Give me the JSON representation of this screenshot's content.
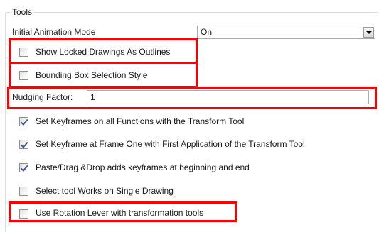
{
  "group": {
    "title": "Tools"
  },
  "animation_mode": {
    "label": "Initial Animation Mode",
    "value": "On"
  },
  "options": [
    {
      "label": "Show Locked Drawings As Outlines",
      "checked": false
    },
    {
      "label": "Bounding Box Selection Style",
      "checked": false
    }
  ],
  "nudging": {
    "label": "Nudging Factor:",
    "value": "1"
  },
  "options2": [
    {
      "label": "Set Keyframes on all Functions with the Transform Tool",
      "checked": true
    },
    {
      "label": "Set Keyframe at Frame One with First Application of the Transform Tool",
      "checked": true
    },
    {
      "label": "Paste/Drag &Drop adds keyframes at beginning and end",
      "checked": true
    },
    {
      "label": "Select tool Works on Single Drawing",
      "checked": false
    },
    {
      "label": "Use Rotation Lever with transformation tools",
      "checked": false
    }
  ],
  "highlight_color": "#ff0000",
  "icons": {
    "dropdown": "chevron-down-icon",
    "checkbox_checked": "checkmark-icon"
  }
}
